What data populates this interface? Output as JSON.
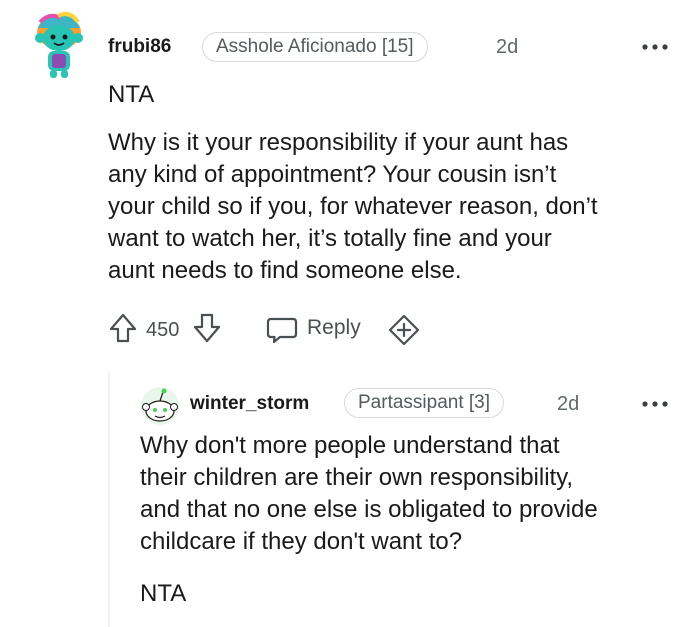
{
  "comments": [
    {
      "username": "frubi86",
      "flair": "Asshole Aficionado [15]",
      "time": "2d",
      "more_icon": "more-horizontal-icon",
      "verdict": "NTA",
      "body": "Why is it your responsibility if your aunt has any kind of appointment? Your cousin isn’t your child so if you, for whatever reason, don’t want to watch her, it’s totally fine and your aunt needs to find someone else.",
      "body_lines": [
        "Why is it your responsibility if your aunt has",
        "any kind of appointment? Your cousin isn’t",
        "your child so if you, for whatever reason, don’t",
        "want to watch her, it’s totally fine and your",
        "aunt needs to find someone else."
      ],
      "votes": "450",
      "reply_label": "Reply",
      "icons": {
        "upvote": "upvote-arrow-icon",
        "downvote": "downvote-arrow-icon",
        "reply": "speech-bubble-icon",
        "award": "add-award-icon"
      }
    },
    {
      "username": "winter_storm",
      "flair": "Partassipant [3]",
      "time": "2d",
      "more_icon": "more-horizontal-icon",
      "body_lines": [
        "Why don't more people understand that",
        "their children are their own responsibility,",
        "and that no one else is obligated to provide",
        "childcare if they don't want to?"
      ],
      "verdict": "NTA"
    }
  ],
  "colors": {
    "text": "#1a1a1b",
    "muted": "#62676b",
    "flair_border": "#d7dadc",
    "thread_line": "#edeff1"
  }
}
